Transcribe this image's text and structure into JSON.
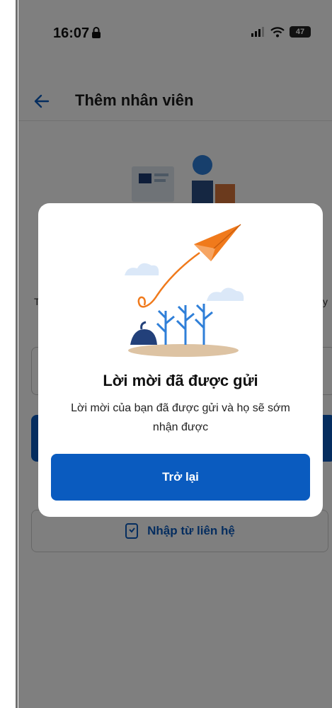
{
  "status_bar": {
    "time": "16:07",
    "battery": "47"
  },
  "header": {
    "title": "Thêm nhân viên"
  },
  "background": {
    "side_text_left": "T",
    "side_text_right": "y",
    "contacts_button_label": "Nhập từ liên hệ"
  },
  "dialog": {
    "title": "Lời mời đã được gửi",
    "message": "Lời mời của bạn đã được gửi và họ sẽ sớm nhận được",
    "button_label": "Trở lại"
  },
  "colors": {
    "primary": "#0a5bbf",
    "accent": "#f07a1c",
    "illustration_blue": "#2f7fd8"
  },
  "icons": {
    "back": "arrow-left-icon",
    "lock": "lock-icon",
    "signal": "cellular-signal-icon",
    "wifi": "wifi-icon",
    "battery": "battery-icon",
    "contacts": "contact-card-icon",
    "dialog_illustration": "paper-plane-plants-illustration"
  }
}
